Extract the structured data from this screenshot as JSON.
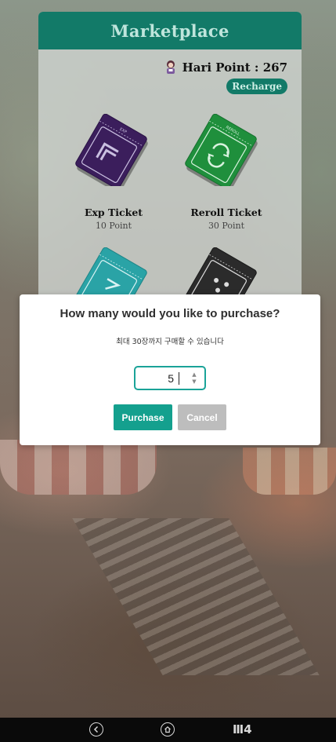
{
  "marketplace": {
    "title": "Marketplace",
    "points_text": "Hari Point : 267",
    "recharge_label": "Recharge",
    "items": [
      {
        "name": "Exp Ticket",
        "price": "10 Point",
        "ticket_label": "EXP",
        "color": "#3b1e5c"
      },
      {
        "name": "Reroll Ticket",
        "price": "30 Point",
        "ticket_label": "REROLL",
        "color": "#1f8f3c"
      },
      {
        "name": "",
        "price": "",
        "ticket_label": "",
        "color": "#2aa3a6"
      },
      {
        "name": "",
        "price": "",
        "ticket_label": "",
        "color": "#2b2b2b"
      }
    ]
  },
  "dialog": {
    "title": "How many would you like to purchase?",
    "subtitle": "최대 30장까지 구매할 수 있습니다",
    "quantity": "5",
    "purchase_label": "Purchase",
    "cancel_label": "Cancel"
  },
  "navbar": {
    "brand": "Ⅲ4"
  },
  "colors": {
    "accent": "#127a68",
    "button_primary": "#14a08e",
    "button_disabled": "#bdbdbd"
  }
}
